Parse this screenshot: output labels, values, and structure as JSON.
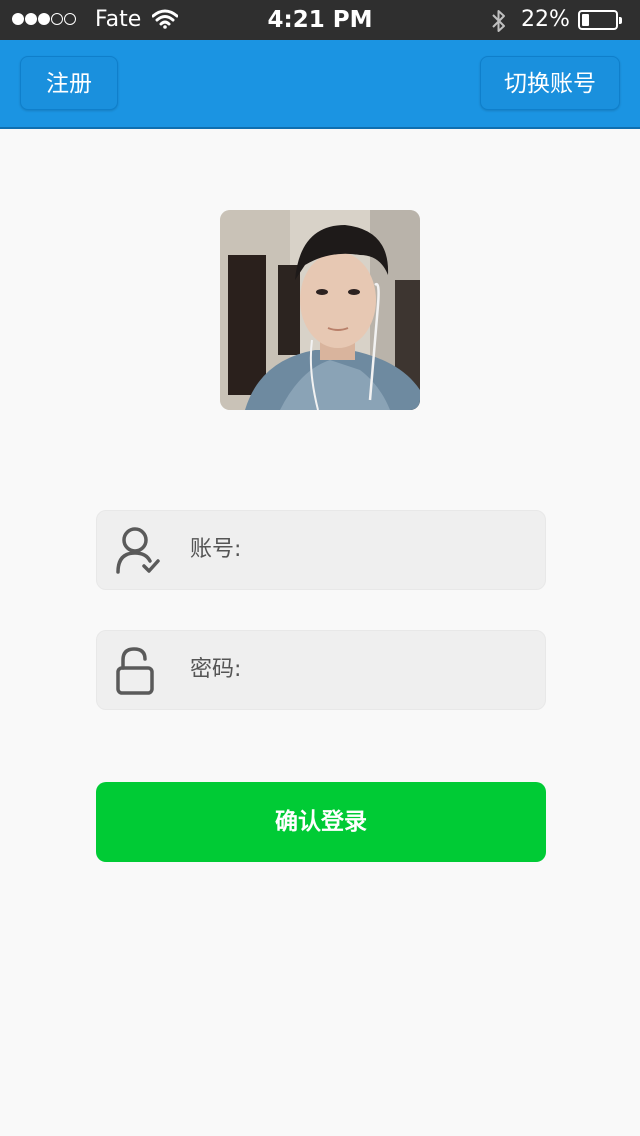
{
  "status_bar": {
    "carrier": "Fate",
    "time": "4:21 PM",
    "battery_percent": "22%",
    "battery_level": 0.22,
    "signal_bars_filled": 3,
    "signal_bars_total": 5
  },
  "navbar": {
    "register_label": "注册",
    "switch_account_label": "切换账号"
  },
  "form": {
    "account_label": "账号:",
    "account_value": "",
    "password_label": "密码:",
    "password_value": "",
    "submit_label": "确认登录"
  },
  "colors": {
    "nav_blue": "#1b94e2",
    "login_green": "#00cb35",
    "field_bg": "#efefef",
    "status_bar_bg": "#2f2f2f"
  },
  "icons": {
    "account": "user-check-icon",
    "password": "unlock-icon",
    "wifi": "wifi-icon",
    "bluetooth": "bluetooth-icon",
    "battery": "battery-icon"
  }
}
